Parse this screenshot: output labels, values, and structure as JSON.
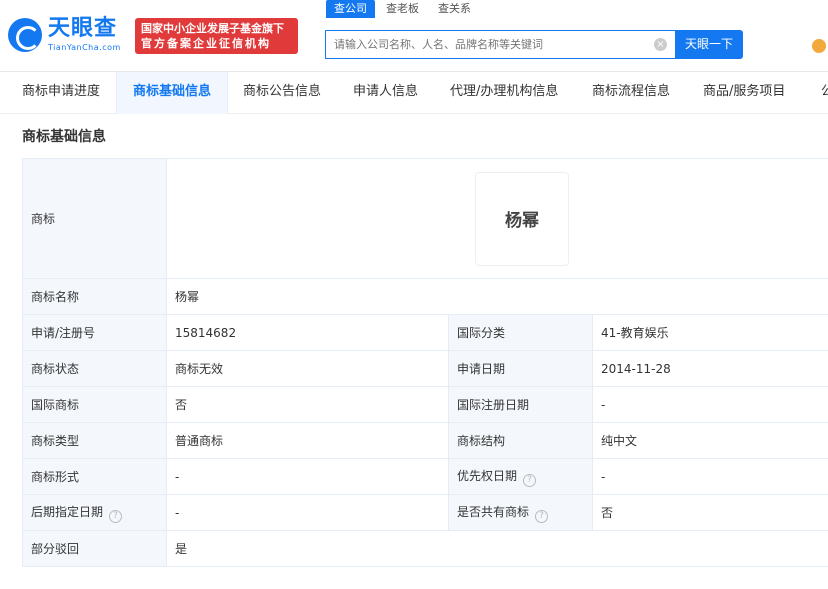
{
  "header": {
    "logo_cn": "天眼查",
    "logo_en": "TianYanCha.com",
    "badge_line1": "国家中小企业发展子基金旗下",
    "badge_line2": "官方备案企业征信机构",
    "search_tabs": [
      "查公司",
      "查老板",
      "查关系"
    ],
    "search_placeholder": "请输入公司名称、人名、品牌名称等关键词",
    "search_button": "天眼一下"
  },
  "nav": {
    "tabs": [
      "商标申请进度",
      "商标基础信息",
      "商标公告信息",
      "申请人信息",
      "代理/办理机构信息",
      "商标流程信息",
      "商品/服务项目",
      "公"
    ]
  },
  "section": {
    "title": "商标基础信息",
    "trademark_label": "商标",
    "trademark_image_text": "杨幂",
    "rows": {
      "name_label": "商标名称",
      "name_value": "杨幂",
      "reg_no_label": "申请/注册号",
      "reg_no_value": "15814682",
      "intl_class_label": "国际分类",
      "intl_class_value": "41-教育娱乐",
      "status_label": "商标状态",
      "status_value": "商标无效",
      "apply_date_label": "申请日期",
      "apply_date_value": "2014-11-28",
      "intl_tm_label": "国际商标",
      "intl_tm_value": "否",
      "intl_reg_date_label": "国际注册日期",
      "intl_reg_date_value": "-",
      "type_label": "商标类型",
      "type_value": "普通商标",
      "structure_label": "商标结构",
      "structure_value": "纯中文",
      "form_label": "商标形式",
      "form_value": "-",
      "priority_date_label": "优先权日期",
      "priority_date_value": "-",
      "later_date_label": "后期指定日期",
      "later_date_value": "-",
      "shared_label": "是否共有商标",
      "shared_value": "否",
      "partial_reject_label": "部分驳回",
      "partial_reject_value": "是"
    }
  }
}
